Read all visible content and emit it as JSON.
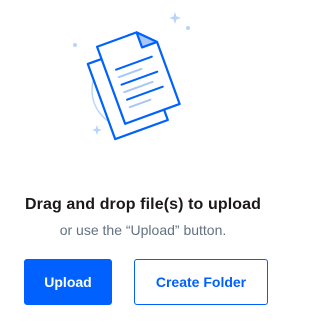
{
  "colors": {
    "accent": "#0061fe",
    "title_text": "#1e1919",
    "muted_text": "#637282"
  },
  "illustration": {
    "icon": "documents-icon"
  },
  "dropzone": {
    "title": "Drag and drop file(s) to upload",
    "subtitle": "or use the “Upload” button."
  },
  "buttons": {
    "upload_label": "Upload",
    "create_folder_label": "Create Folder"
  }
}
